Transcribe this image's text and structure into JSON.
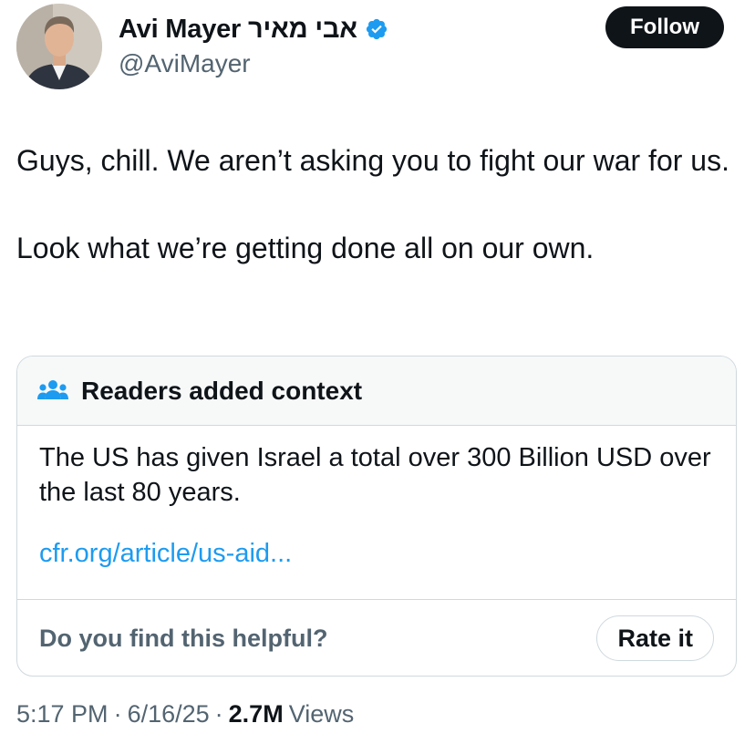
{
  "author": {
    "display_name": "Avi Mayer אבי מאיר",
    "handle": "@AviMayer",
    "verified": true,
    "avatar_icon": "profile-photo"
  },
  "follow_button": {
    "label": "Follow"
  },
  "tweet": {
    "paragraphs": [
      "Guys, chill. We aren’t asking you to fight our war for us.",
      "Look what we’re getting done all on our own."
    ]
  },
  "community_note": {
    "header_icon": "people-icon",
    "header_title": "Readers added context",
    "text": "The US has given Israel a total over 300 Billion USD over the last 80 years.",
    "link": "cfr.org/article/us-aid...",
    "helpful_question": "Do you find this helpful?",
    "rate_button": "Rate it"
  },
  "meta": {
    "time": "5:17 PM",
    "separator": "·",
    "date": "6/16/25",
    "views_count": "2.7M",
    "views_label": "Views"
  },
  "colors": {
    "accent_link": "#1d9bf0",
    "verified_badge": "#1d9bf0",
    "follow_bg": "#0f1419",
    "secondary_text": "#536471",
    "border": "#cfd9de"
  }
}
